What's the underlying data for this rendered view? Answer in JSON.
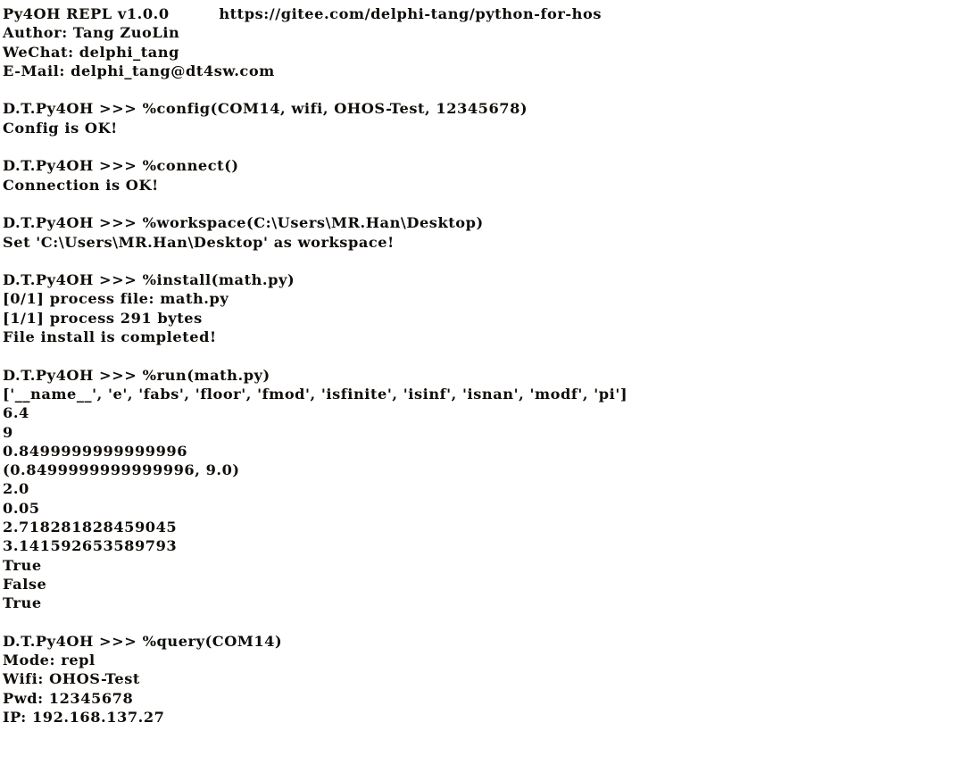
{
  "app": {
    "title": "Py4OH REPL v1.0.0",
    "repo_url": "https://gitee.com/delphi-tang/python-for-hos",
    "prompt": "D.T.Py4OH >>> ",
    "background_color": "#ffffff",
    "text_color": "#100c08"
  },
  "banner": {
    "title_line": "Py4OH REPL v1.0.0         https://gitee.com/delphi-tang/python-for-hos",
    "author": "Author: Tang ZuoLin",
    "wechat": "WeChat: delphi_tang",
    "email": "E-Mail: delphi_tang@dt4sw.com",
    "author_label": "Author:",
    "author_value": "Tang ZuoLin",
    "wechat_label": "WeChat:",
    "wechat_value": "delphi_tang",
    "email_label": "E-Mail:",
    "email_value": "delphi_tang@dt4sw.com"
  },
  "session": {
    "blocks": [
      {
        "command": "D.T.Py4OH >>> %config(COM14, wifi, OHOS-Test, 12345678)",
        "output": [
          "Config is OK!"
        ]
      },
      {
        "command": "D.T.Py4OH >>> %connect()",
        "output": [
          "Connection is OK!"
        ]
      },
      {
        "command": "D.T.Py4OH >>> %workspace(C:\\Users\\MR.Han\\Desktop)",
        "output": [
          "Set 'C:\\Users\\MR.Han\\Desktop' as workspace!"
        ]
      },
      {
        "command": "D.T.Py4OH >>> %install(math.py)",
        "output": [
          "[0/1] process file: math.py",
          "[1/1] process 291 bytes",
          "File install is completed!"
        ]
      },
      {
        "command": "D.T.Py4OH >>> %run(math.py)",
        "output": [
          "['__name__', 'e', 'fabs', 'floor', 'fmod', 'isfinite', 'isinf', 'isnan', 'modf', 'pi']",
          "6.4",
          "9",
          "0.8499999999999996",
          "(0.8499999999999996, 9.0)",
          "2.0",
          "0.05",
          "2.718281828459045",
          "3.141592653589793",
          "True",
          "False",
          "True"
        ]
      },
      {
        "command": "D.T.Py4OH >>> %query(COM14)",
        "output": [
          "Mode: repl",
          "Wifi: OHOS-Test",
          "Pwd: 12345678",
          "IP: 192.168.137.27"
        ]
      }
    ]
  },
  "lines": [
    "Py4OH REPL v1.0.0         https://gitee.com/delphi-tang/python-for-hos",
    "Author: Tang ZuoLin",
    "WeChat: delphi_tang",
    "E-Mail: delphi_tang@dt4sw.com",
    "",
    "D.T.Py4OH >>> %config(COM14, wifi, OHOS-Test, 12345678)",
    "Config is OK!",
    "",
    "D.T.Py4OH >>> %connect()",
    "Connection is OK!",
    "",
    "D.T.Py4OH >>> %workspace(C:\\Users\\MR.Han\\Desktop)",
    "Set 'C:\\Users\\MR.Han\\Desktop' as workspace!",
    "",
    "D.T.Py4OH >>> %install(math.py)",
    "[0/1] process file: math.py",
    "[1/1] process 291 bytes",
    "File install is completed!",
    "",
    "D.T.Py4OH >>> %run(math.py)",
    "['__name__', 'e', 'fabs', 'floor', 'fmod', 'isfinite', 'isinf', 'isnan', 'modf', 'pi']",
    "6.4",
    "9",
    "0.8499999999999996",
    "(0.8499999999999996, 9.0)",
    "2.0",
    "0.05",
    "2.718281828459045",
    "3.141592653589793",
    "True",
    "False",
    "True",
    "",
    "D.T.Py4OH >>> %query(COM14)",
    "Mode: repl",
    "Wifi: OHOS-Test",
    "Pwd: 12345678",
    "IP: 192.168.137.27"
  ]
}
